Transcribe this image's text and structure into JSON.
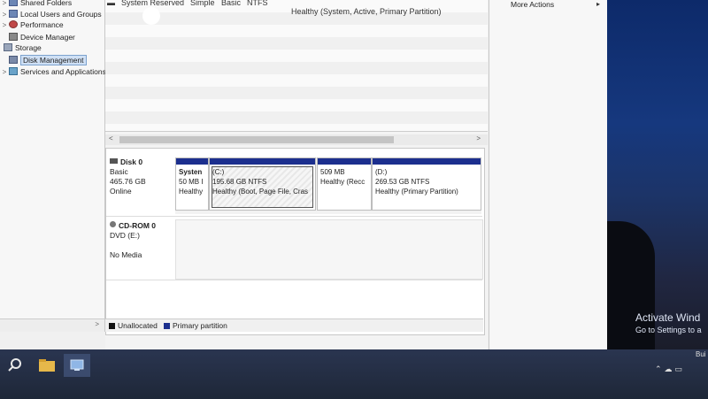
{
  "tree": {
    "items": [
      {
        "label": "Shared Folders",
        "caret": ">"
      },
      {
        "label": "Local Users and Groups",
        "caret": ">"
      },
      {
        "label": "Performance",
        "caret": ">"
      },
      {
        "label": "Device Manager",
        "caret": ""
      },
      {
        "label": "Storage",
        "caret": ""
      },
      {
        "label": "Disk Management",
        "caret": "",
        "selected": true
      },
      {
        "label": "Services and Applications",
        "caret": ">"
      }
    ],
    "scroll_arrow": ">"
  },
  "volume_list": {
    "row": {
      "volume": "System Reserved",
      "layout": "Simple",
      "type": "Basic",
      "fs": "NTFS",
      "status": "Healthy (System, Active, Primary Partition)"
    },
    "scroll_left": "<",
    "scroll_right": ">"
  },
  "disks": [
    {
      "name": "Disk 0",
      "type": "Basic",
      "size": "465.76 GB",
      "state": "Online",
      "partitions": [
        {
          "title": "Systen",
          "size": "50 MB I",
          "status": "Healthy"
        },
        {
          "title": "(C:)",
          "size": "195.68 GB NTFS",
          "status": "Healthy (Boot, Page File, Cras"
        },
        {
          "title": "",
          "size": "509 MB",
          "status": "Healthy (Recc"
        },
        {
          "title": "(D:)",
          "size": "269.53 GB NTFS",
          "status": "Healthy (Primary Partition)"
        }
      ]
    },
    {
      "name": "CD-ROM 0",
      "type": "DVD (E:)",
      "state": "No Media"
    }
  ],
  "legend": {
    "unallocated": "Unallocated",
    "primary": "Primary partition",
    "unallocated_color": "#111111",
    "primary_color": "#1c2f8e"
  },
  "actions": {
    "more_actions": "More Actions",
    "arrow": "▸"
  },
  "desktop": {
    "activate_title": "Activate Wind",
    "activate_sub": "Go to Settings to a",
    "tray_text": "Bui"
  },
  "taskbar": {
    "icons": [
      "search-icon",
      "file-explorer-icon",
      "computer-management-icon"
    ]
  }
}
